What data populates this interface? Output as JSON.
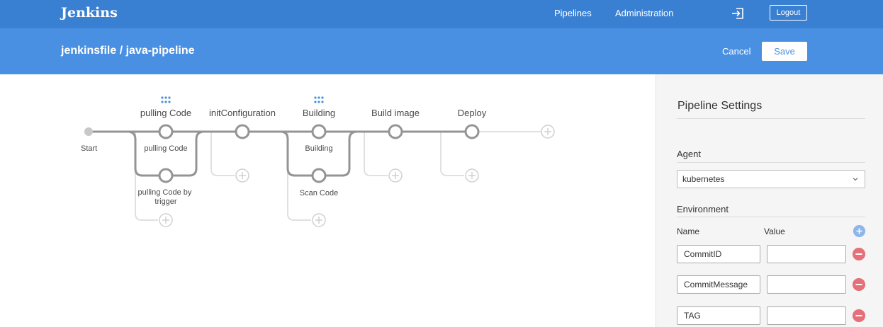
{
  "topbar": {
    "brand": "Jenkins",
    "nav": [
      "Pipelines",
      "Administration"
    ],
    "exit_icon": "sign-out-icon",
    "logout_label": "Logout",
    "color": "#3a80d2"
  },
  "header": {
    "title": "jenkinsfile / java-pipeline",
    "cancel_label": "Cancel",
    "save_label": "Save",
    "color": "#4a90e2"
  },
  "pipeline": {
    "start_label": "Start",
    "stages": [
      {
        "name": "pulling Code",
        "parallel": [
          "pulling Code",
          "pulling Code by trigger"
        ]
      },
      {
        "name": "initConfiguration",
        "parallel": []
      },
      {
        "name": "Building",
        "parallel": [
          "Building",
          "Scan Code"
        ]
      },
      {
        "name": "Build image",
        "parallel": []
      },
      {
        "name": "Deploy",
        "parallel": []
      }
    ],
    "wrap_label": "pulling Code by trigger",
    "wrap_lines": [
      "pulling Code by",
      "trigger"
    ]
  },
  "settings": {
    "title": "Pipeline Settings",
    "agent_label": "Agent",
    "agent_value": "kubernetes",
    "environment_label": "Environment",
    "name_header": "Name",
    "value_header": "Value",
    "env": [
      {
        "name": "CommitID",
        "value": ""
      },
      {
        "name": "CommitMessage",
        "value": ""
      },
      {
        "name": "TAG",
        "value": ""
      }
    ],
    "add_color": "#8fb6ea",
    "remove_color": "#e5707a"
  }
}
